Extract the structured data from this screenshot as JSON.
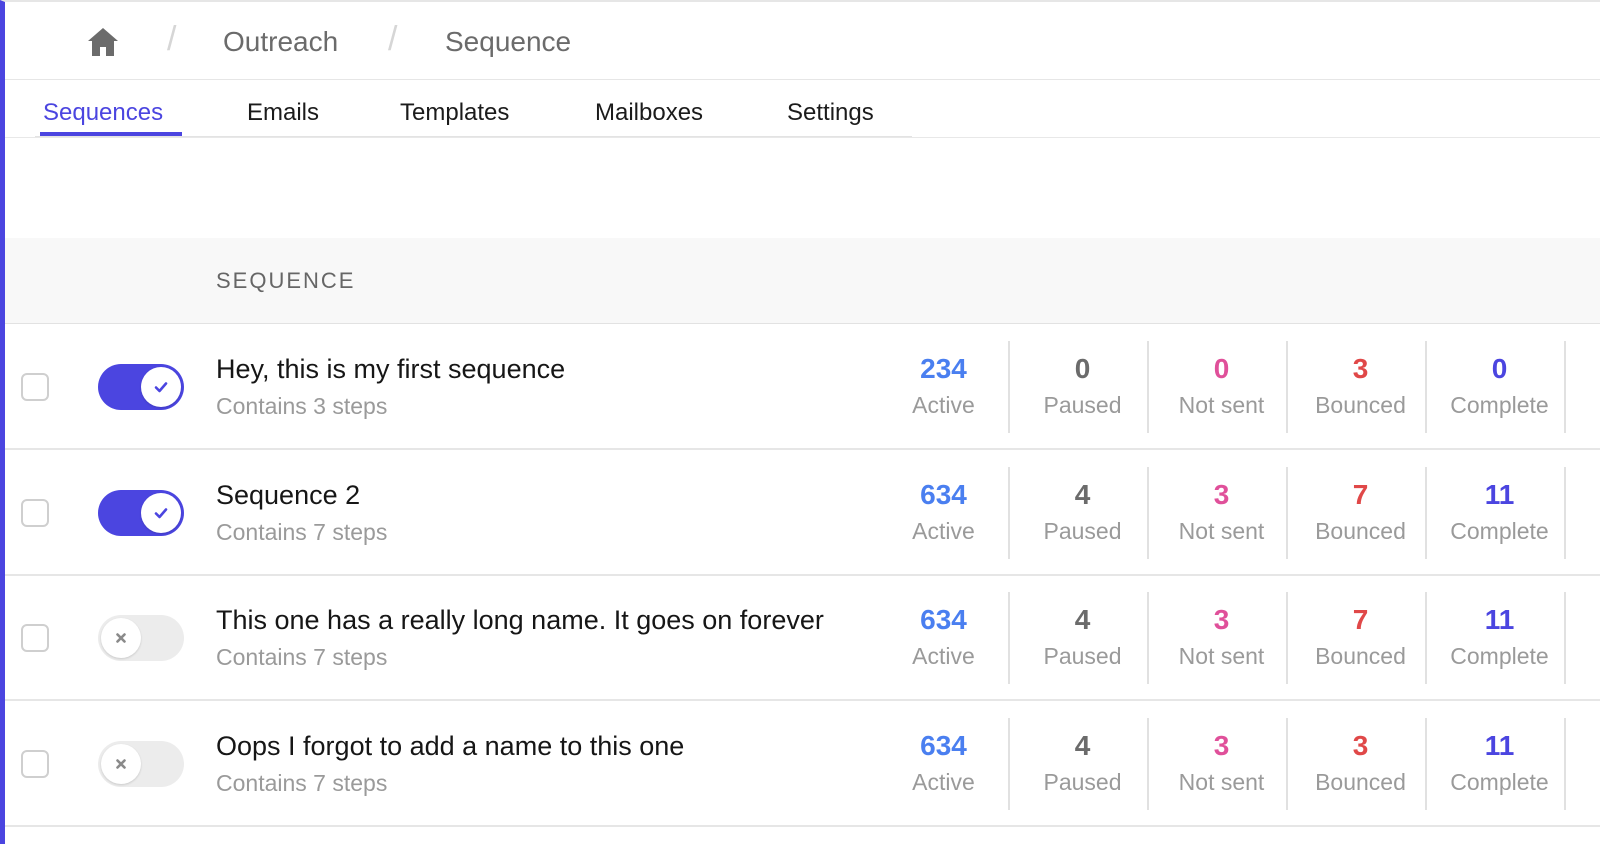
{
  "colors": {
    "accent": "#4b45e0",
    "active": "#4a7ff0",
    "paused": "#6b6b6b",
    "not_sent": "#e0509a",
    "bounced": "#e04848",
    "complete": "#4b45e0"
  },
  "breadcrumb": {
    "home_icon": "home-icon",
    "items": [
      "Outreach",
      "Sequence"
    ]
  },
  "tabs": [
    {
      "label": "Sequences",
      "active": true
    },
    {
      "label": "Emails",
      "active": false
    },
    {
      "label": "Templates",
      "active": false
    },
    {
      "label": "Mailboxes",
      "active": false
    },
    {
      "label": "Settings",
      "active": false
    }
  ],
  "table": {
    "column_title": "SEQUENCE",
    "stat_labels": {
      "active": "Active",
      "paused": "Paused",
      "not_sent": "Not sent",
      "bounced": "Bounced",
      "complete": "Complete"
    },
    "rows": [
      {
        "enabled": true,
        "name": "Hey, this is my first sequence",
        "steps": "Contains 3 steps",
        "active": "234",
        "paused": "0",
        "not_sent": "0",
        "bounced": "3",
        "complete": "0"
      },
      {
        "enabled": true,
        "name": "Sequence 2",
        "steps": "Contains 7 steps",
        "active": "634",
        "paused": "4",
        "not_sent": "3",
        "bounced": "7",
        "complete": "11"
      },
      {
        "enabled": false,
        "name": "This one has a really long name. It goes on forever",
        "steps": "Contains 7 steps",
        "active": "634",
        "paused": "4",
        "not_sent": "3",
        "bounced": "7",
        "complete": "11"
      },
      {
        "enabled": false,
        "name": "Oops I forgot to add a name to this one",
        "steps": "Contains 7 steps",
        "active": "634",
        "paused": "4",
        "not_sent": "3",
        "bounced": "3",
        "complete": "11"
      }
    ]
  }
}
